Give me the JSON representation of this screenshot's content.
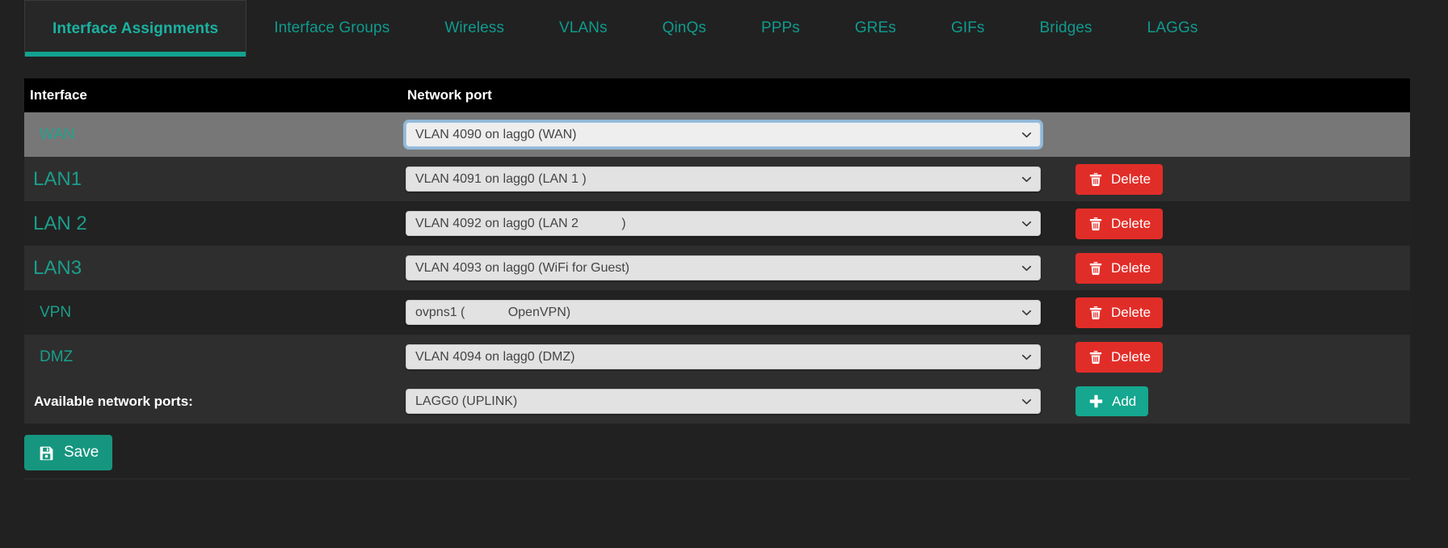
{
  "tabs": [
    {
      "label": "Interface Assignments",
      "active": true
    },
    {
      "label": "Interface Groups",
      "active": false
    },
    {
      "label": "Wireless",
      "active": false
    },
    {
      "label": "VLANs",
      "active": false
    },
    {
      "label": "QinQs",
      "active": false
    },
    {
      "label": "PPPs",
      "active": false
    },
    {
      "label": "GREs",
      "active": false
    },
    {
      "label": "GIFs",
      "active": false
    },
    {
      "label": "Bridges",
      "active": false
    },
    {
      "label": "LAGGs",
      "active": false
    }
  ],
  "table": {
    "headers": {
      "interface": "Interface",
      "network_port": "Network port"
    },
    "rows": [
      {
        "interface": "WAN",
        "port": "VLAN 4090 on lagg0 (WAN)",
        "size": "sm",
        "hovered": true,
        "focused": true,
        "has_delete": false,
        "delete_label": "Delete"
      },
      {
        "interface": "LAN1",
        "port": "VLAN 4091 on lagg0 (LAN 1 )",
        "size": "lg",
        "hovered": false,
        "focused": false,
        "has_delete": true,
        "delete_label": "Delete"
      },
      {
        "interface": "LAN 2",
        "port": "VLAN 4092 on lagg0 (LAN 2            )",
        "size": "lg",
        "hovered": false,
        "focused": false,
        "has_delete": true,
        "delete_label": "Delete"
      },
      {
        "interface": "LAN3",
        "port": "VLAN 4093 on lagg0 (WiFi for Guest)",
        "size": "lg",
        "hovered": false,
        "focused": false,
        "has_delete": true,
        "delete_label": "Delete"
      },
      {
        "interface": "VPN",
        "port": "ovpns1 (            OpenVPN)",
        "size": "sm",
        "hovered": false,
        "focused": false,
        "has_delete": true,
        "delete_label": "Delete"
      },
      {
        "interface": "DMZ",
        "port": "VLAN 4094 on lagg0 (DMZ)",
        "size": "sm",
        "hovered": false,
        "focused": false,
        "has_delete": true,
        "delete_label": "Delete"
      }
    ],
    "available_row": {
      "label": "Available network ports:",
      "port": "LAGG0 (UPLINK)",
      "add_label": "Add"
    }
  },
  "footer": {
    "save_label": "Save"
  },
  "icons": {
    "delete": "trash-icon",
    "add": "plus-icon",
    "save": "floppy-disk-icon",
    "dropdown": "chevron-down-icon"
  },
  "colors": {
    "accent": "#15a78f",
    "danger": "#e12d28",
    "link": "#1b9e8b",
    "page_bg": "#212121",
    "header_bg": "#000000",
    "row_hover": "#777777"
  }
}
